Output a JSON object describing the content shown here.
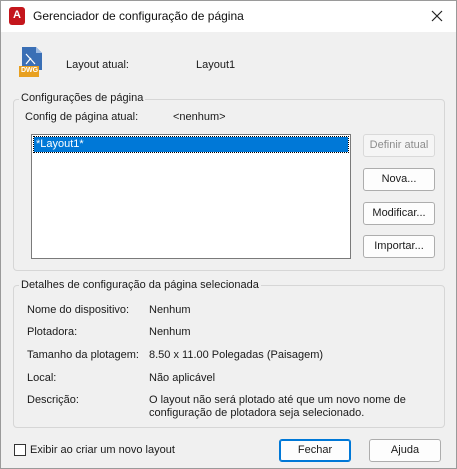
{
  "window": {
    "title": "Gerenciador de configuração de página"
  },
  "header": {
    "file_icon_text": "DWG",
    "current_layout_label": "Layout atual:",
    "current_layout_value": "Layout1"
  },
  "page_setups": {
    "group_title": "Configurações de página",
    "current_setup_label": "Config de página atual:",
    "current_setup_value": "<nenhum>",
    "list_items": [
      "*Layout1*"
    ],
    "buttons": {
      "set_current": "Definir atual",
      "new": "Nova...",
      "modify": "Modificar...",
      "import": "Importar..."
    }
  },
  "details": {
    "group_title": "Detalhes de configuração da página selecionada",
    "rows": [
      {
        "label": "Nome do dispositivo:",
        "value": "Nenhum"
      },
      {
        "label": "Plotadora:",
        "value": "Nenhum"
      },
      {
        "label": "Tamanho da plotagem:",
        "value": "8.50 x 11.00 Polegadas (Paisagem)"
      },
      {
        "label": "Local:",
        "value": "Não aplicável"
      },
      {
        "label": "Descrição:",
        "value_line1": "O layout não será plotado até que um novo nome de",
        "value_line2": "configuração de plotadora seja selecionado."
      }
    ]
  },
  "footer": {
    "checkbox_label": "Exibir ao criar um novo layout",
    "checkbox_checked": false,
    "close_button": "Fechar",
    "help_button": "Ajuda"
  },
  "colors": {
    "brand": "#c4161c",
    "selection": "#0078d7"
  }
}
